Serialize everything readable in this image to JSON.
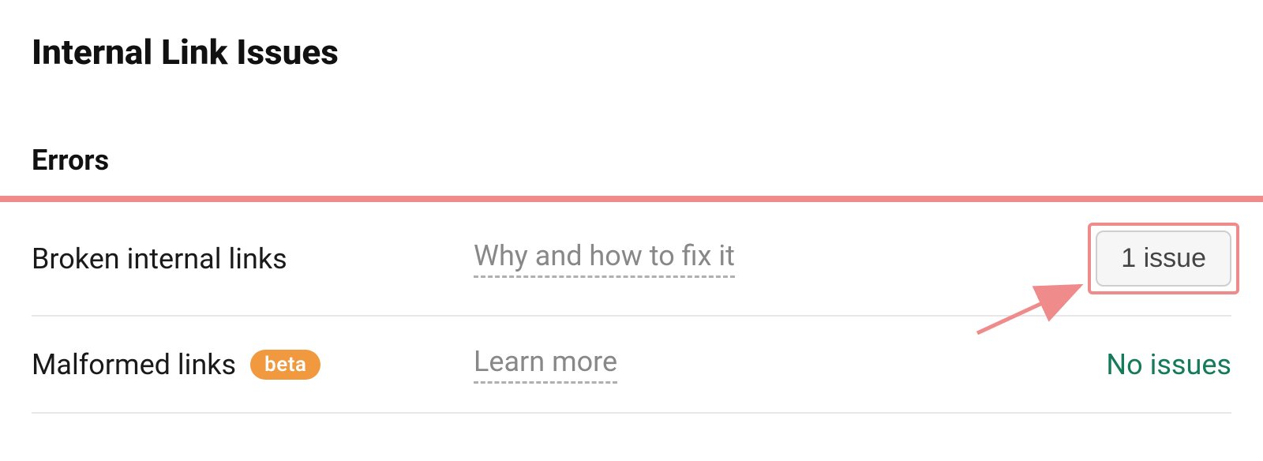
{
  "header": {
    "title": "Internal Link Issues"
  },
  "section": {
    "title": "Errors"
  },
  "rows": [
    {
      "name": "Broken internal links",
      "beta": null,
      "help_label": "Why and how to fix it",
      "status_type": "button",
      "status_label": "1 issue",
      "highlighted": true
    },
    {
      "name": "Malformed links",
      "beta": "beta",
      "help_label": "Learn more",
      "status_type": "text",
      "status_label": "No issues",
      "highlighted": false
    }
  ],
  "colors": {
    "accent_red": "#ef8b8b",
    "beta_orange": "#f0993e",
    "success_green": "#147a5a"
  }
}
